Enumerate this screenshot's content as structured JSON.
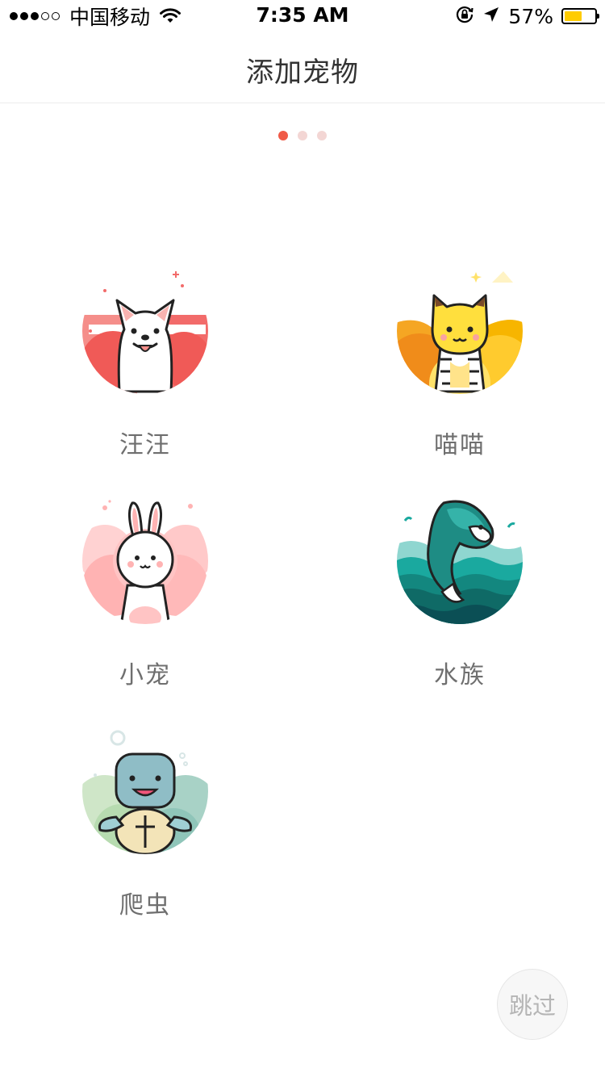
{
  "status_bar": {
    "carrier": "中国移动",
    "time": "7:35 AM",
    "battery_percent": "57%",
    "battery_level": 0.57,
    "signal_bars_filled": 3,
    "signal_bars_total": 5,
    "icons": [
      "wifi-icon",
      "orientation-lock-icon",
      "location-arrow-icon",
      "battery-icon"
    ],
    "battery_color": "#ffcc00"
  },
  "nav": {
    "title": "添加宠物"
  },
  "pager": {
    "page_count": 3,
    "current_page": 1,
    "active_color": "#f05a47",
    "inactive_color": "#f3d6d4"
  },
  "pets": [
    {
      "label": "汪汪",
      "icon": "dog-icon"
    },
    {
      "label": "喵喵",
      "icon": "cat-icon"
    },
    {
      "label": "小宠",
      "icon": "rabbit-icon"
    },
    {
      "label": "水族",
      "icon": "fish-icon"
    },
    {
      "label": "爬虫",
      "icon": "turtle-icon"
    }
  ],
  "skip": {
    "label": "跳过"
  }
}
